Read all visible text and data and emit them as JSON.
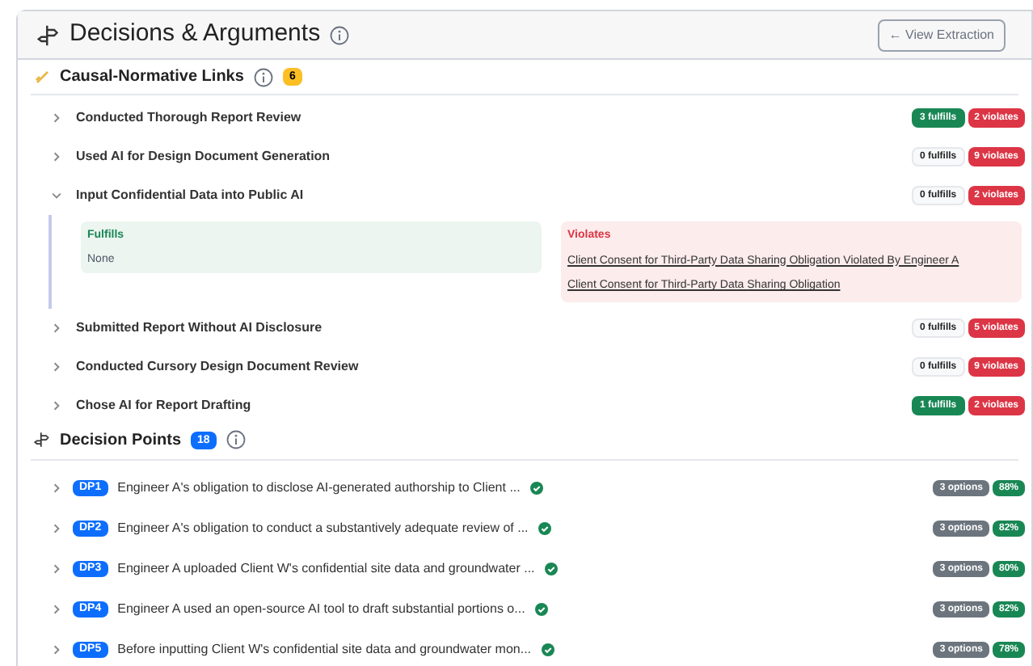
{
  "header": {
    "title": "Decisions & Arguments",
    "button": "← View Extraction"
  },
  "links": {
    "title": "Causal-Normative Links",
    "count": "6",
    "rows": [
      {
        "label": "Conducted Thorough Report Review",
        "expanded": false,
        "fulfills": "3 fulfills",
        "fulfills_active": true,
        "violates": "2 violates"
      },
      {
        "label": "Used AI for Design Document Generation",
        "expanded": false,
        "fulfills": "0 fulfills",
        "fulfills_active": false,
        "violates": "9 violates"
      },
      {
        "label": "Input Confidential Data into Public AI",
        "expanded": true,
        "fulfills": "0 fulfills",
        "fulfills_active": false,
        "violates": "2 violates",
        "detail": {
          "fulfills_title": "Fulfills",
          "fulfills_items": [
            "None"
          ],
          "violates_title": "Violates",
          "violates_items": [
            "Client Consent for Third-Party Data Sharing Obligation Violated By Engineer A",
            "Client Consent for Third-Party Data Sharing Obligation"
          ]
        }
      },
      {
        "label": "Submitted Report Without AI Disclosure",
        "expanded": false,
        "fulfills": "0 fulfills",
        "fulfills_active": false,
        "violates": "5 violates"
      },
      {
        "label": "Conducted Cursory Design Document Review",
        "expanded": false,
        "fulfills": "0 fulfills",
        "fulfills_active": false,
        "violates": "9 violates"
      },
      {
        "label": "Chose AI for Report Drafting",
        "expanded": false,
        "fulfills": "1 fulfills",
        "fulfills_active": true,
        "violates": "2 violates"
      }
    ]
  },
  "decisions": {
    "title": "Decision Points",
    "count": "18",
    "rows": [
      {
        "id": "DP1",
        "text": "Engineer A's obligation to disclose AI-generated authorship to Client ...",
        "verified": true,
        "options": "3 options",
        "score": "88%"
      },
      {
        "id": "DP2",
        "text": "Engineer A's obligation to conduct a substantively adequate review of ...",
        "verified": true,
        "options": "3 options",
        "score": "82%"
      },
      {
        "id": "DP3",
        "text": "Engineer A uploaded Client W's confidential site data and groundwater ...",
        "verified": true,
        "options": "3 options",
        "score": "80%"
      },
      {
        "id": "DP4",
        "text": "Engineer A used an open-source AI tool to draft substantial portions o...",
        "verified": true,
        "options": "3 options",
        "score": "82%"
      },
      {
        "id": "DP5",
        "text": "Before inputting Client W's confidential site data and groundwater mon...",
        "verified": true,
        "options": "3 options",
        "score": "78%"
      }
    ]
  }
}
